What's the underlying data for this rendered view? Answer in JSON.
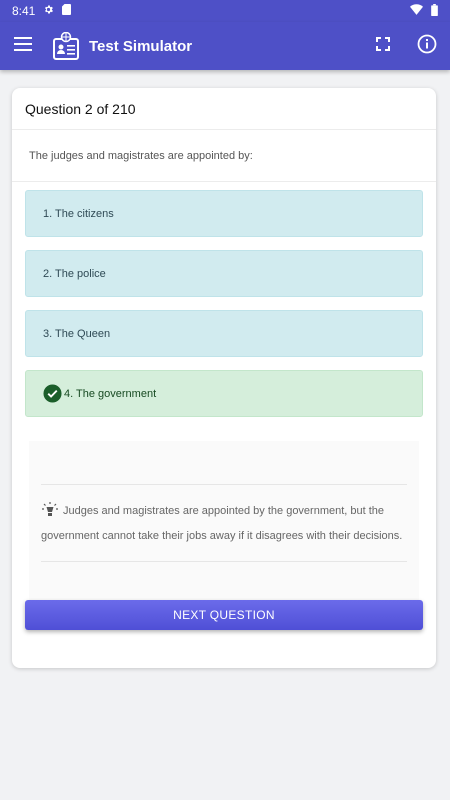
{
  "status_bar": {
    "time": "8:41"
  },
  "app_bar": {
    "title": "Test Simulator"
  },
  "quiz": {
    "header": "Question 2 of 210",
    "question": "The judges and magistrates are appointed by:",
    "answers": [
      {
        "label": "1. The citizens",
        "state": "default"
      },
      {
        "label": "2. The police",
        "state": "default"
      },
      {
        "label": "3. The Queen",
        "state": "default"
      },
      {
        "label": "4. The government",
        "state": "correct"
      }
    ],
    "explanation": "Judges and magistrates are appointed by the government, but the government cannot take their jobs away if it disagrees with their decisions.",
    "next_label": "NEXT QUESTION"
  },
  "colors": {
    "primary": "#4e50c7",
    "answer_bg": "#d1ebef",
    "correct_bg": "#d5eedb",
    "correct_icon": "#1b5e2a"
  },
  "icons": [
    "settings-icon",
    "sd-card-icon",
    "wifi-icon",
    "battery-icon",
    "menu-icon",
    "app-logo-icon",
    "fullscreen-icon",
    "info-icon",
    "check-circle-icon",
    "lightbulb-icon"
  ]
}
